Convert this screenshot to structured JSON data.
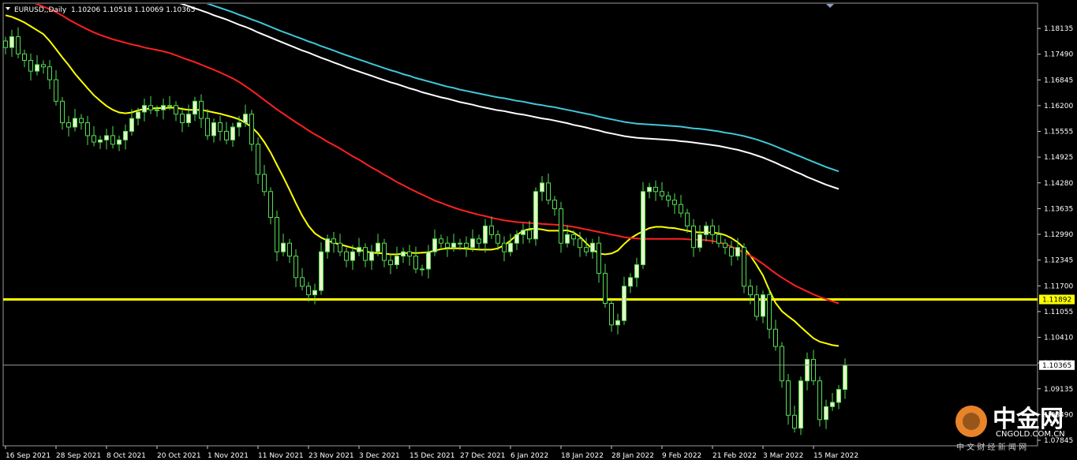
{
  "chart_data": {
    "type": "candlestick",
    "title": "EURUSD,,Daily",
    "ohlc_header": "1.10206 1.10518 1.10069 1.10365",
    "ylim": [
      1.0849,
      1.1878
    ],
    "y_ticks": [
      "1.18135",
      "1.17490",
      "1.16845",
      "1.16200",
      "1.15555",
      "1.14925",
      "1.14280",
      "1.13635",
      "1.12990",
      "1.12345",
      "1.11700",
      "1.11055",
      "1.10410",
      "1.09780",
      "1.09135",
      "1.08490",
      "1.07845"
    ],
    "x_labels": [
      {
        "i": 0,
        "label": "16 Sep 2021"
      },
      {
        "i": 8,
        "label": "28 Sep 2021"
      },
      {
        "i": 16,
        "label": "8 Oct 2021"
      },
      {
        "i": 24,
        "label": "20 Oct 2021"
      },
      {
        "i": 32,
        "label": "1 Nov 2021"
      },
      {
        "i": 40,
        "label": "11 Nov 2021"
      },
      {
        "i": 48,
        "label": "23 Nov 2021"
      },
      {
        "i": 56,
        "label": "3 Dec 2021"
      },
      {
        "i": 64,
        "label": "15 Dec 2021"
      },
      {
        "i": 72,
        "label": "27 Dec 2021"
      },
      {
        "i": 80,
        "label": "6 Jan 2022"
      },
      {
        "i": 88,
        "label": "18 Jan 2022"
      },
      {
        "i": 96,
        "label": "28 Jan 2022"
      },
      {
        "i": 104,
        "label": "9 Feb 2022"
      },
      {
        "i": 112,
        "label": "21 Feb 2022"
      },
      {
        "i": 120,
        "label": "3 Mar 2022"
      },
      {
        "i": 128,
        "label": "15 Mar 2022"
      }
    ],
    "hline": {
      "value": 1.11892,
      "label": "1.11892",
      "color": "#ffff00"
    },
    "current_price": {
      "value": 1.10365,
      "label": "1.10365"
    },
    "candle_colors": {
      "bull": "#e8f5c8",
      "bear": "#000000",
      "wick": "#55dd55"
    },
    "close": [
      1.1775,
      1.18,
      1.176,
      1.1745,
      1.172,
      1.1735,
      1.173,
      1.17,
      1.165,
      1.16,
      1.159,
      1.161,
      1.16,
      1.157,
      1.1555,
      1.156,
      1.157,
      1.155,
      1.156,
      1.158,
      1.161,
      1.1625,
      1.164,
      1.163,
      1.163,
      1.164,
      1.164,
      1.162,
      1.16,
      1.162,
      1.165,
      1.161,
      1.157,
      1.16,
      1.158,
      1.156,
      1.159,
      1.16,
      1.162,
      1.155,
      1.148,
      1.144,
      1.138,
      1.13,
      1.132,
      1.129,
      1.124,
      1.122,
      1.12,
      1.121,
      1.13,
      1.133,
      1.132,
      1.13,
      1.128,
      1.13,
      1.131,
      1.128,
      1.13,
      1.132,
      1.128,
      1.127,
      1.129,
      1.13,
      1.129,
      1.126,
      1.126,
      1.13,
      1.133,
      1.132,
      1.131,
      1.132,
      1.132,
      1.131,
      1.133,
      1.132,
      1.136,
      1.134,
      1.132,
      1.13,
      1.132,
      1.134,
      1.135,
      1.133,
      1.144,
      1.146,
      1.142,
      1.14,
      1.132,
      1.134,
      1.133,
      1.131,
      1.13,
      1.132,
      1.125,
      1.118,
      1.113,
      1.114,
      1.122,
      1.124,
      1.127,
      1.144,
      1.145,
      1.144,
      1.143,
      1.142,
      1.141,
      1.139,
      1.136,
      1.131,
      1.134,
      1.136,
      1.134,
      1.132,
      1.131,
      1.129,
      1.131,
      1.122,
      1.12,
      1.115,
      1.12,
      1.112,
      1.108,
      1.1,
      1.092,
      1.089,
      1.1,
      1.105,
      1.1,
      1.091,
      1.094,
      1.095,
      1.098,
      1.1036
    ],
    "series": [
      {
        "name": "",
        "color": "#ffff00",
        "values": [
          1.185,
          1.1846,
          1.184,
          1.1833,
          1.1824,
          1.1815,
          1.1806,
          1.179,
          1.1771,
          1.1752,
          1.1734,
          1.1714,
          1.1697,
          1.168,
          1.1664,
          1.1651,
          1.1639,
          1.163,
          1.1624,
          1.1622,
          1.1624,
          1.1629,
          1.1632,
          1.1633,
          1.1634,
          1.1634,
          1.1635,
          1.1635,
          1.1632,
          1.163,
          1.163,
          1.163,
          1.1627,
          1.1624,
          1.1621,
          1.1617,
          1.1613,
          1.1608,
          1.16,
          1.159,
          1.1575,
          1.1555,
          1.1531,
          1.1502,
          1.1474,
          1.1444,
          1.1413,
          1.1384,
          1.136,
          1.1343,
          1.1333,
          1.1326,
          1.1321,
          1.1317,
          1.1313,
          1.1309,
          1.1305,
          1.1301,
          1.1298,
          1.1297,
          1.1296,
          1.1294,
          1.1294,
          1.1296,
          1.1298,
          1.1297,
          1.1298,
          1.1299,
          1.1303,
          1.1306,
          1.1308,
          1.1308,
          1.1308,
          1.1307,
          1.1306,
          1.1305,
          1.1305,
          1.1305,
          1.1308,
          1.1315,
          1.1326,
          1.1339,
          1.1349,
          1.1353,
          1.1354,
          1.1352,
          1.1349,
          1.1349,
          1.1349,
          1.135,
          1.1345,
          1.1335,
          1.132,
          1.1306,
          1.1296,
          1.1294,
          1.1296,
          1.1303,
          1.1318,
          1.1331,
          1.134,
          1.1348,
          1.1355,
          1.1358,
          1.1358,
          1.1356,
          1.1355,
          1.1352,
          1.1349,
          1.1346,
          1.1345,
          1.1345,
          1.1345,
          1.1343,
          1.1339,
          1.1332,
          1.1322,
          1.1309,
          1.1291,
          1.1269,
          1.1245,
          1.1211,
          1.1181,
          1.1162,
          1.115,
          1.1139,
          1.1125,
          1.1112,
          1.1099,
          1.1091,
          1.1087,
          1.1083,
          1.1081
        ]
      },
      {
        "name": "",
        "color": "#ff2020",
        "values": [
          1.1904,
          1.1897,
          1.1891,
          1.1886,
          1.1881,
          1.1876,
          1.187,
          1.1864,
          1.1857,
          1.1849,
          1.184,
          1.1832,
          1.1824,
          1.1817,
          1.181,
          1.1804,
          1.1799,
          1.1794,
          1.179,
          1.1786,
          1.1782,
          1.1779,
          1.1775,
          1.1772,
          1.1769,
          1.1766,
          1.1762,
          1.1757,
          1.1751,
          1.1746,
          1.1741,
          1.1735,
          1.1729,
          1.1723,
          1.1717,
          1.171,
          1.1703,
          1.1695,
          1.1685,
          1.1675,
          1.1664,
          1.1653,
          1.1642,
          1.1631,
          1.1621,
          1.1611,
          1.1601,
          1.1592,
          1.1582,
          1.1573,
          1.1565,
          1.1556,
          1.1548,
          1.154,
          1.1531,
          1.1522,
          1.1514,
          1.1505,
          1.1496,
          1.1488,
          1.1479,
          1.1471,
          1.1462,
          1.1455,
          1.1447,
          1.144,
          1.1433,
          1.1426,
          1.1419,
          1.1414,
          1.1408,
          1.1403,
          1.1398,
          1.1394,
          1.139,
          1.1386,
          1.1383,
          1.1379,
          1.1376,
          1.1373,
          1.1371,
          1.1369,
          1.1368,
          1.1367,
          1.1366,
          1.1365,
          1.1364,
          1.1363,
          1.1362,
          1.136,
          1.1358,
          1.1355,
          1.1352,
          1.1349,
          1.1346,
          1.1343,
          1.134,
          1.1337,
          1.1334,
          1.1332,
          1.1331,
          1.133,
          1.133,
          1.133,
          1.133,
          1.133,
          1.133,
          1.133,
          1.1329,
          1.1328,
          1.1328,
          1.1327,
          1.1325,
          1.1322,
          1.1318,
          1.1312,
          1.1305,
          1.1298,
          1.1291,
          1.1282,
          1.1272,
          1.1261,
          1.125,
          1.124,
          1.1231,
          1.1222,
          1.1215,
          1.1208,
          1.1201,
          1.1195,
          1.119,
          1.1185,
          1.118
        ]
      },
      {
        "name": "",
        "color": "#ffffff",
        "values": [
          1.199,
          1.1986,
          1.1981,
          1.1977,
          1.1972,
          1.1968,
          1.1964,
          1.196,
          1.1957,
          1.1953,
          1.195,
          1.1946,
          1.1943,
          1.1939,
          1.1936,
          1.1932,
          1.1928,
          1.1924,
          1.192,
          1.1916,
          1.1912,
          1.1908,
          1.1904,
          1.19,
          1.1895,
          1.1891,
          1.1886,
          1.1881,
          1.1876,
          1.1871,
          1.1866,
          1.1861,
          1.1856,
          1.185,
          1.1845,
          1.184,
          1.1834,
          1.1828,
          1.1823,
          1.1817,
          1.181,
          1.1804,
          1.1798,
          1.1792,
          1.1786,
          1.178,
          1.1774,
          1.1768,
          1.1763,
          1.1757,
          1.1751,
          1.1746,
          1.174,
          1.1735,
          1.1729,
          1.1724,
          1.1719,
          1.1714,
          1.1709,
          1.1704,
          1.1699,
          1.1694,
          1.169,
          1.1685,
          1.168,
          1.1676,
          1.1671,
          1.1667,
          1.1663,
          1.1659,
          1.1656,
          1.1652,
          1.1648,
          1.1645,
          1.1642,
          1.1638,
          1.1635,
          1.1632,
          1.1629,
          1.1627,
          1.1624,
          1.1621,
          1.1619,
          1.1616,
          1.1613,
          1.161,
          1.1608,
          1.1605,
          1.1602,
          1.1599,
          1.1595,
          1.1592,
          1.1589,
          1.1585,
          1.1582,
          1.1578,
          1.1575,
          1.1572,
          1.1569,
          1.1567,
          1.1565,
          1.1564,
          1.1563,
          1.1562,
          1.1561,
          1.156,
          1.1559,
          1.1557,
          1.1556,
          1.1554,
          1.1552,
          1.155,
          1.1548,
          1.1546,
          1.1543,
          1.154,
          1.1537,
          1.1533,
          1.1529,
          1.1524,
          1.1519,
          1.1513,
          1.1507,
          1.15,
          1.1494,
          1.1487,
          1.1481,
          1.1474,
          1.1468,
          1.1462,
          1.1456,
          1.1451,
          1.1446
        ]
      },
      {
        "name": "",
        "color": "#3fc8d8",
        "values": [
          1.2005,
          1.2001,
          1.1997,
          1.1993,
          1.1988,
          1.1984,
          1.198,
          1.1976,
          1.1972,
          1.1968,
          1.1965,
          1.1961,
          1.1958,
          1.1955,
          1.1951,
          1.1948,
          1.1944,
          1.194,
          1.1937,
          1.1933,
          1.1929,
          1.1925,
          1.1921,
          1.1917,
          1.1913,
          1.1909,
          1.1905,
          1.19,
          1.1896,
          1.1891,
          1.1887,
          1.1882,
          1.1877,
          1.1872,
          1.1867,
          1.1862,
          1.1857,
          1.1851,
          1.1846,
          1.184,
          1.1835,
          1.1829,
          1.1823,
          1.1817,
          1.1811,
          1.1806,
          1.18,
          1.1795,
          1.1789,
          1.1784,
          1.1778,
          1.1773,
          1.1768,
          1.1762,
          1.1757,
          1.1752,
          1.1747,
          1.1742,
          1.1737,
          1.1732,
          1.1727,
          1.1722,
          1.1718,
          1.1713,
          1.1709,
          1.1704,
          1.17,
          1.1696,
          1.1692,
          1.1688,
          1.1684,
          1.1681,
          1.1677,
          1.1674,
          1.1671,
          1.1668,
          1.1665,
          1.1662,
          1.1659,
          1.1657,
          1.1654,
          1.1651,
          1.1649,
          1.1646,
          1.1643,
          1.1641,
          1.1638,
          1.1636,
          1.1633,
          1.163,
          1.1627,
          1.1624,
          1.1621,
          1.1618,
          1.1614,
          1.1611,
          1.1608,
          1.1605,
          1.1602,
          1.16,
          1.1598,
          1.1597,
          1.1596,
          1.1595,
          1.1594,
          1.1593,
          1.1592,
          1.1591,
          1.1589,
          1.1587,
          1.1586,
          1.1584,
          1.1582,
          1.158,
          1.1577,
          1.1575,
          1.1572,
          1.1569,
          1.1565,
          1.1561,
          1.1556,
          1.1551,
          1.1545,
          1.1539,
          1.1533,
          1.1527,
          1.1521,
          1.1515,
          1.1509,
          1.1503,
          1.1497,
          1.1492,
          1.1487
        ]
      }
    ]
  },
  "watermark": {
    "cn": "中金网",
    "en": "CNGOLD.COM.CN",
    "sub": "中 文 财 经 新 闻 网"
  }
}
